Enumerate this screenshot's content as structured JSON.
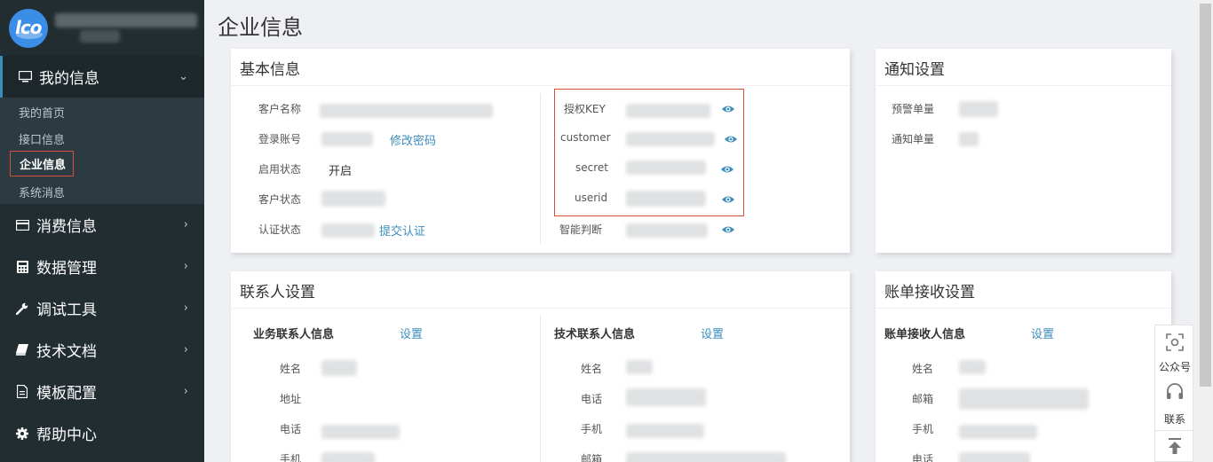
{
  "sidebar": {
    "menu": [
      {
        "label": "我的信息",
        "icon": "monitor-icon",
        "arrow": "⌄"
      },
      {
        "label": "消费信息",
        "icon": "credit-card-icon",
        "arrow": "›"
      },
      {
        "label": "数据管理",
        "icon": "calculator-icon",
        "arrow": "›"
      },
      {
        "label": "调试工具",
        "icon": "wrench-icon",
        "arrow": "›"
      },
      {
        "label": "技术文档",
        "icon": "book-icon",
        "arrow": "›"
      },
      {
        "label": "模板配置",
        "icon": "file-icon",
        "arrow": "›"
      },
      {
        "label": "帮助中心",
        "icon": "gear-icon",
        "arrow": ""
      }
    ],
    "submenu": [
      "我的首页",
      "接口信息",
      "企业信息",
      "系统消息"
    ]
  },
  "page": {
    "title": "企业信息"
  },
  "basic": {
    "title": "基本信息",
    "labels": [
      "客户名称",
      "登录账号",
      "启用状态",
      "客户状态",
      "认证状态"
    ],
    "status_value": "开启",
    "change_password": "修改密码",
    "submit_cert": "提交认证",
    "key_labels": [
      "授权KEY",
      "customer",
      "secret",
      "userid",
      "智能判断"
    ]
  },
  "notify": {
    "title": "通知设置",
    "labels": [
      "预警单量",
      "通知单量"
    ]
  },
  "contacts": {
    "title": "联系人设置",
    "business_title": "业务联系人信息",
    "tech_title": "技术联系人信息",
    "set_label": "设置",
    "business_labels": [
      "姓名",
      "地址",
      "电话",
      "手机"
    ],
    "tech_labels": [
      "姓名",
      "电话",
      "手机",
      "邮箱"
    ]
  },
  "bill": {
    "title": "账单接收设置",
    "receiver_title": "账单接收人信息",
    "set_label": "设置",
    "labels": [
      "姓名",
      "邮箱",
      "手机",
      "电话"
    ]
  },
  "floatbar": {
    "wechat_label": "公众号",
    "contact_label": "联系"
  }
}
